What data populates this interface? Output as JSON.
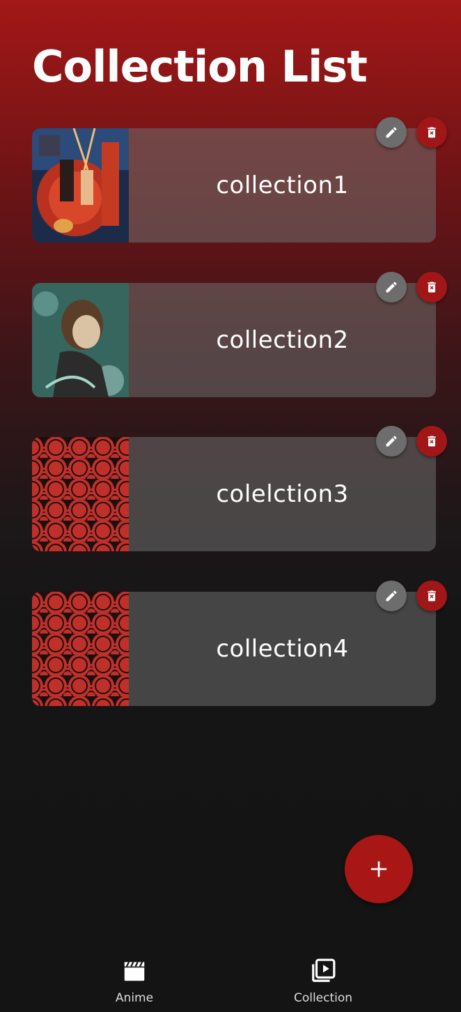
{
  "header": {
    "title": "Collection List"
  },
  "collections": [
    {
      "name": "collection1",
      "thumbnail": "anime-cast-artwork"
    },
    {
      "name": "collection2",
      "thumbnail": "anime-character-artwork"
    },
    {
      "name": "colelction3",
      "thumbnail": "red-wave-pattern"
    },
    {
      "name": "collection4",
      "thumbnail": "red-wave-pattern"
    }
  ],
  "actions": {
    "edit_icon": "pencil-icon",
    "delete_icon": "trash-icon",
    "add_icon": "plus-icon"
  },
  "nav": {
    "items": [
      {
        "label": "Anime",
        "icon": "clapperboard-icon"
      },
      {
        "label": "Collection",
        "icon": "video-library-icon"
      }
    ]
  },
  "colors": {
    "accent": "#a81616",
    "card": "#5a5a5a",
    "background": "#141414"
  }
}
